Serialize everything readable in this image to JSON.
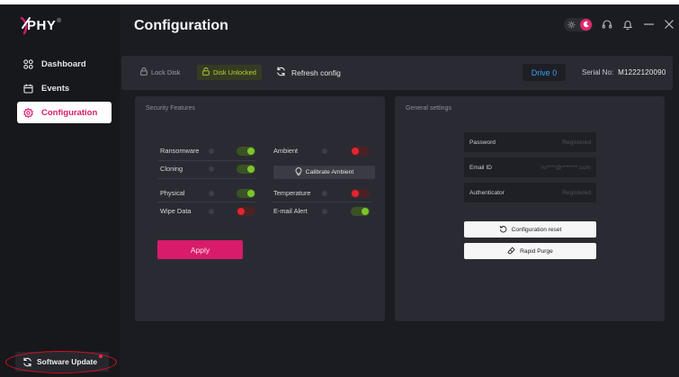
{
  "app": {
    "logo": "PHY",
    "logo_mark": "®"
  },
  "sidebar": {
    "items": [
      {
        "label": "Dashboard",
        "icon": "grid-icon"
      },
      {
        "label": "Events",
        "icon": "calendar-icon"
      },
      {
        "label": "Configuration",
        "icon": "gear-icon",
        "active": true
      }
    ],
    "software_update": "Software Update"
  },
  "header": {
    "title": "Configuration",
    "theme": "dark"
  },
  "disk_bar": {
    "lock": "Lock Disk",
    "unlock": "Disk Unlocked",
    "refresh": "Refresh config",
    "drive": "Drive 0",
    "serial_label": "Serial No:",
    "serial_value": "M1222120090"
  },
  "security": {
    "title": "Security Features",
    "features": [
      {
        "label": "Ransomware",
        "state": "on"
      },
      {
        "label": "Cloning",
        "state": "on"
      },
      {
        "label": "Physical",
        "state": "on"
      },
      {
        "label": "Wipe Data",
        "state": "off"
      }
    ],
    "features_right": [
      {
        "label": "Ambient",
        "state": "off"
      },
      {
        "label": "Temperature",
        "state": "off"
      },
      {
        "label": "E-mail Alert",
        "state": "on"
      }
    ],
    "calibrate": "Calibrate Ambient",
    "apply": "Apply"
  },
  "general": {
    "title": "General settings",
    "fields": [
      {
        "label": "Password",
        "value": "Registered"
      },
      {
        "label": "Email ID",
        "value": "ru****@*******.com"
      },
      {
        "label": "Authenticator",
        "value": "Registered"
      }
    ],
    "reset": "Configuration reset",
    "purge": "Rapid Purge"
  },
  "colors": {
    "accent": "#d81b6a",
    "on": "#7dc52b",
    "off": "#e2252e",
    "drive": "#3aa0ef",
    "annotation": "#d80f1f"
  }
}
